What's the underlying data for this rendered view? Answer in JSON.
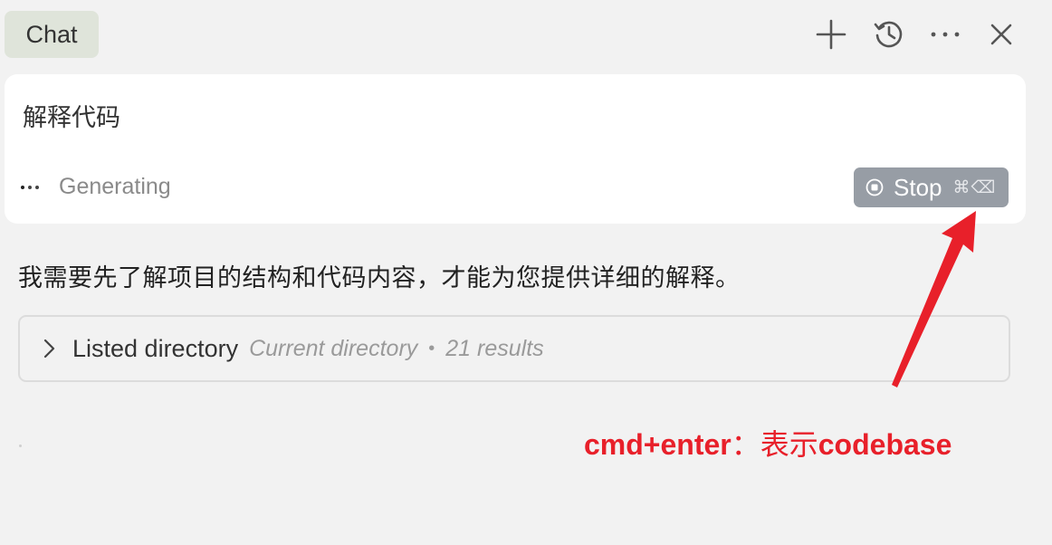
{
  "header": {
    "tab_label": "Chat",
    "actions": [
      {
        "icon": "plus-icon",
        "name": "new-chat-button"
      },
      {
        "icon": "history-icon",
        "name": "history-button"
      },
      {
        "icon": "more-icon",
        "name": "more-button"
      },
      {
        "icon": "close-icon",
        "name": "close-button"
      }
    ]
  },
  "prompt": {
    "text": "解释代码",
    "status_text": "Generating",
    "stop_label": "Stop",
    "stop_shortcut": "⌘⌫"
  },
  "response": {
    "text": "我需要先了解项目的结构和代码内容，才能为您提供详细的解释。",
    "tool_call": {
      "title": "Listed directory",
      "target": "Current directory",
      "separator": "•",
      "result_count": "21 results"
    }
  },
  "annotation": {
    "text_prefix": "cmd+enter",
    "text_cn": "：表示",
    "text_suffix": "codebase",
    "color": "#e8202a"
  },
  "colors": {
    "background": "#f2f2f2",
    "card": "#ffffff",
    "tab_active": "#dfe4da",
    "stop_button": "#979da5",
    "annotation": "#e8202a"
  }
}
